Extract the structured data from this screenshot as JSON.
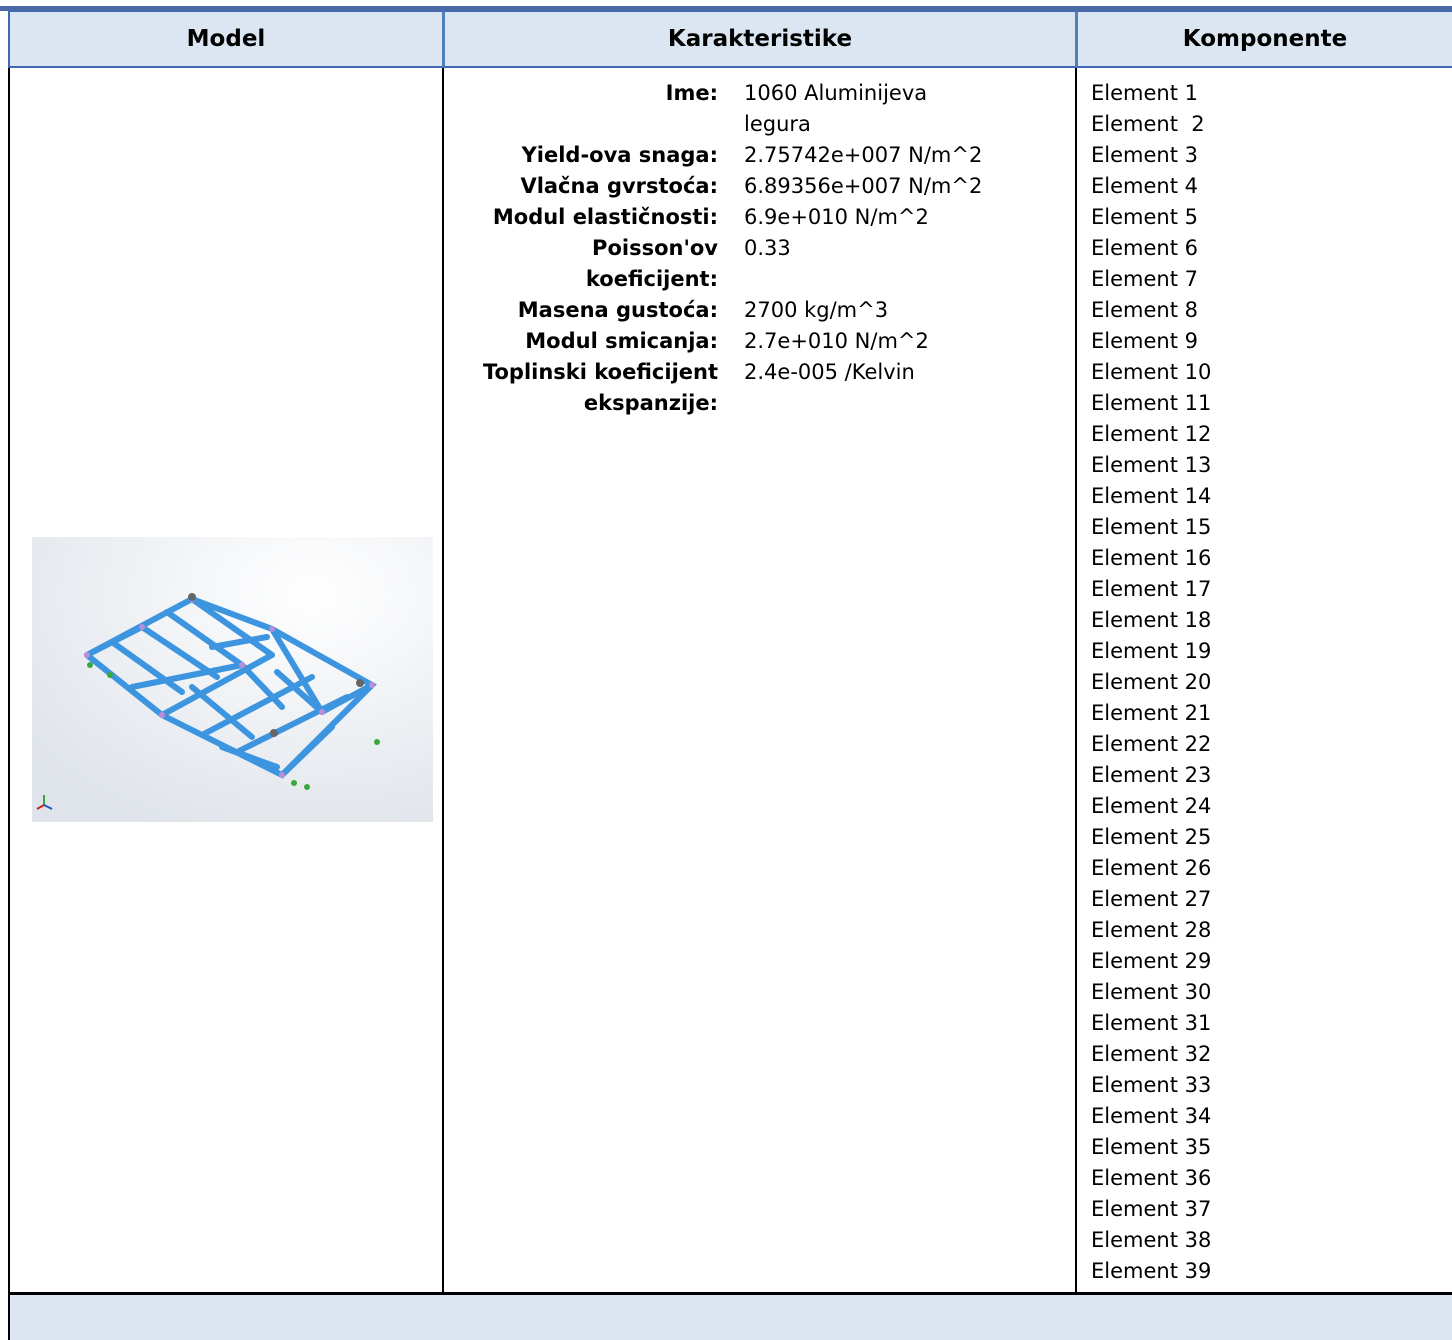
{
  "header": {
    "model": "Model",
    "karakteristike": "Karakteristike",
    "komponente": "Komponente"
  },
  "properties": [
    {
      "label": "Ime:",
      "value": "1060 Aluminijeva\nlegura"
    },
    {
      "label": "Yield-ova snaga:",
      "value": "2.75742e+007 N/m^2"
    },
    {
      "label": "Vlačna gvrstoća:",
      "value": "6.89356e+007 N/m^2"
    },
    {
      "label": "Modul elastičnosti:",
      "value": "6.9e+010 N/m^2"
    },
    {
      "label": "Poisson'ov\nkoeficijent:",
      "value": "0.33"
    },
    {
      "label": "Masena gustoća:",
      "value": "2700 kg/m^3"
    },
    {
      "label": "Modul smicanja:",
      "value": "2.7e+010 N/m^2"
    },
    {
      "label": "Toplinski koeficijent\nekspanzije:",
      "value": "2.4e-005 /Kelvin"
    }
  ],
  "components": [
    "Element 1",
    "Element  2",
    "Element 3",
    "Element 4",
    "Element 5",
    "Element 6",
    "Element 7",
    "Element 8",
    "Element 9",
    "Element 10",
    "Element 11",
    "Element 12",
    "Element 13",
    "Element 14",
    "Element 15",
    "Element 16",
    "Element 17",
    "Element 18",
    "Element 19",
    "Element 20",
    "Element 21",
    "Element 22",
    "Element 23",
    "Element 24",
    "Element 25",
    "Element 26",
    "Element 27",
    "Element 28",
    "Element 29",
    "Element 30",
    "Element 31",
    "Element 32",
    "Element 33",
    "Element 34",
    "Element 35",
    "Element 36",
    "Element 37",
    "Element 38",
    "Element 39"
  ],
  "colors": {
    "header_bg": "#dce6f2",
    "frame_blue": "#3f67b3",
    "truss_blue": "#3d95e0"
  },
  "icons": {
    "model_picture": "truss-frame-render",
    "axis_triad": "axis-triad-icon"
  }
}
